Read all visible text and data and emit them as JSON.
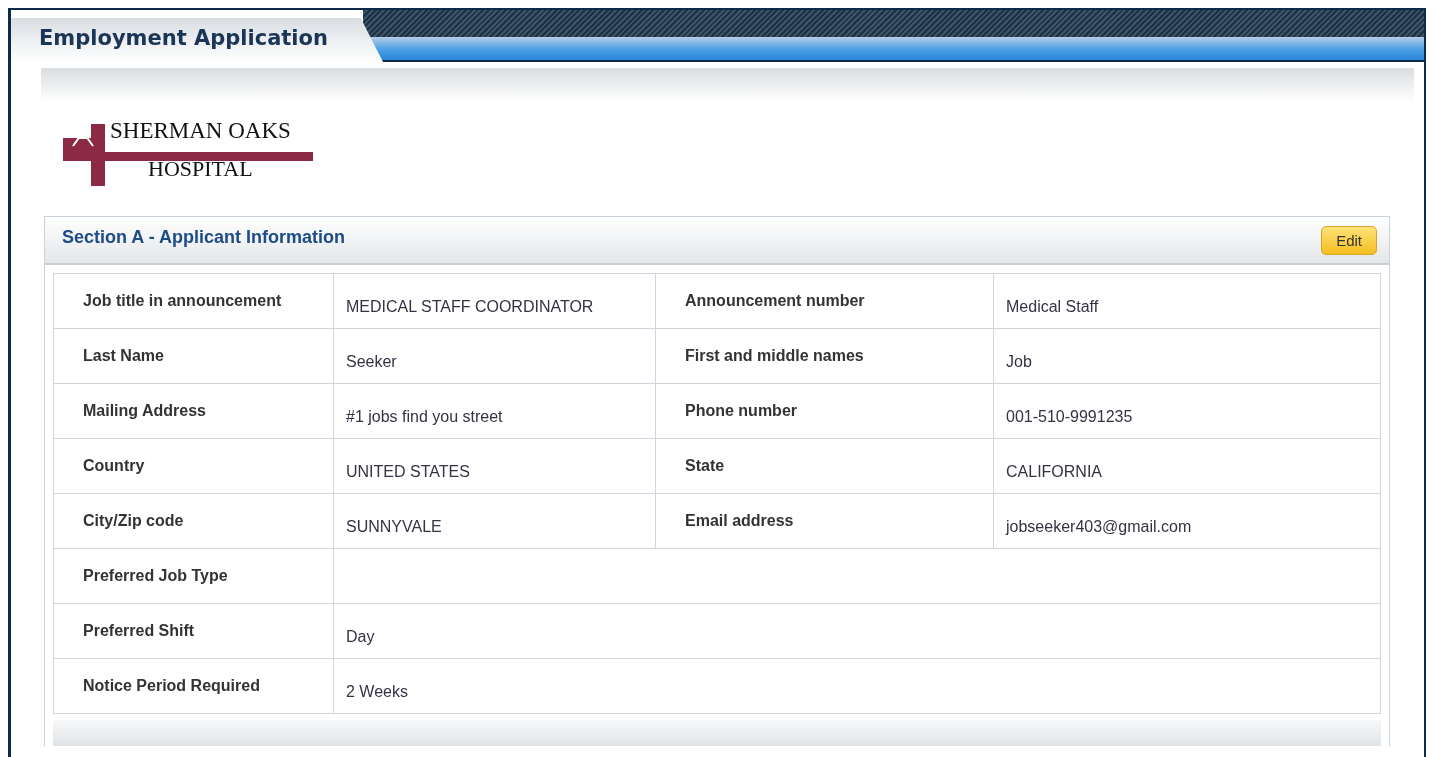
{
  "window": {
    "title": "Employment Application"
  },
  "logo": {
    "line_1": "SHERMAN OAKS",
    "line_2": "HOSPITAL"
  },
  "section": {
    "title": "Section A - Applicant Information",
    "edit_button": "Edit",
    "rows": [
      {
        "fields": [
          {
            "label": "Job title in announcement",
            "value": "MEDICAL STAFF COORDINATOR"
          },
          {
            "label": "Announcement number",
            "value": "Medical Staff"
          }
        ]
      },
      {
        "fields": [
          {
            "label": "Last Name",
            "value": "Seeker"
          },
          {
            "label": "First and middle names",
            "value": "Job"
          }
        ]
      },
      {
        "fields": [
          {
            "label": "Mailing Address",
            "value": "#1 jobs find you street"
          },
          {
            "label": "Phone number",
            "value": "001-510-9991235"
          }
        ]
      },
      {
        "fields": [
          {
            "label": "Country",
            "value": "UNITED STATES"
          },
          {
            "label": "State",
            "value": "CALIFORNIA"
          }
        ]
      },
      {
        "fields": [
          {
            "label": "City/Zip code",
            "value": "SUNNYVALE"
          },
          {
            "label": "Email address",
            "value": "jobseeker403@gmail.com"
          }
        ]
      },
      {
        "fields": [
          {
            "label": "Preferred Job Type"
          }
        ]
      },
      {
        "fields": [
          {
            "label": "Preferred Shift",
            "value": "Day"
          }
        ]
      },
      {
        "fields": [
          {
            "label": "Notice Period Required",
            "value": "2 Weeks"
          }
        ]
      }
    ]
  }
}
